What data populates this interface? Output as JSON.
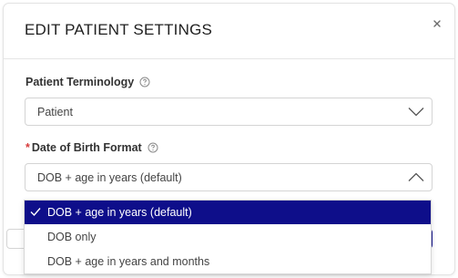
{
  "modal": {
    "title": "EDIT PATIENT SETTINGS",
    "close_icon": "close-icon"
  },
  "fields": {
    "terminology": {
      "label": "Patient Terminology",
      "value": "Patient",
      "help_icon": "help-circle-icon"
    },
    "dob_format": {
      "required_marker": "*",
      "label": "Date of Birth Format",
      "value": "DOB + age in years (default)",
      "help_icon": "help-circle-icon",
      "options": [
        {
          "label": "DOB + age in years (default)",
          "selected": true
        },
        {
          "label": "DOB only",
          "selected": false
        },
        {
          "label": "DOB + age in years and months",
          "selected": false
        }
      ]
    }
  },
  "colors": {
    "selected_option_bg": "#0e0e8a",
    "selected_option_text": "#ffffff",
    "required_marker": "#d63b3b"
  }
}
